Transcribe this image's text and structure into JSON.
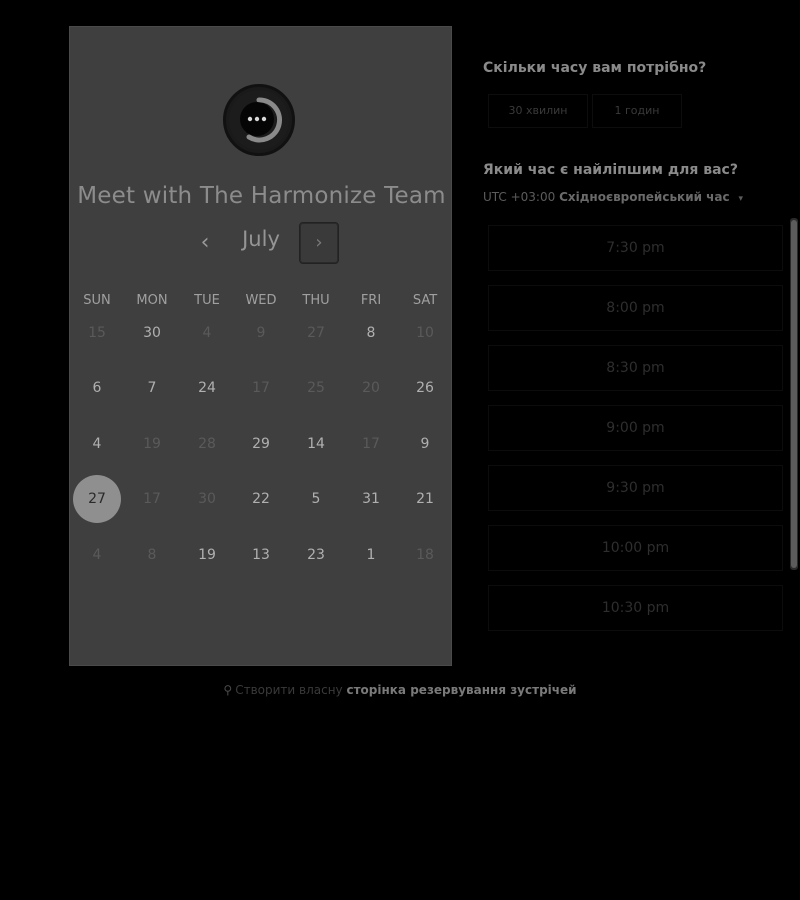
{
  "calendar": {
    "title": "Meet with The Harmonize Team",
    "month": "July",
    "prev_icon": "‹",
    "next_icon": "›",
    "weekdays": [
      "SUN",
      "MON",
      "TUE",
      "WED",
      "THU",
      "FRI",
      "SAT"
    ],
    "weeks": [
      [
        {
          "d": "15",
          "m": true
        },
        {
          "d": "30",
          "m": false
        },
        {
          "d": "4",
          "m": true
        },
        {
          "d": "9",
          "m": true
        },
        {
          "d": "27",
          "m": true
        },
        {
          "d": "8",
          "m": false
        },
        {
          "d": "10",
          "m": true
        }
      ],
      [
        {
          "d": "6",
          "m": false
        },
        {
          "d": "7",
          "m": false
        },
        {
          "d": "24",
          "m": false
        },
        {
          "d": "17",
          "m": true
        },
        {
          "d": "25",
          "m": true
        },
        {
          "d": "20",
          "m": true
        },
        {
          "d": "26",
          "m": false
        }
      ],
      [
        {
          "d": "4",
          "m": false
        },
        {
          "d": "19",
          "m": true
        },
        {
          "d": "28",
          "m": true
        },
        {
          "d": "29",
          "m": false
        },
        {
          "d": "14",
          "m": false
        },
        {
          "d": "17",
          "m": true
        },
        {
          "d": "9",
          "m": false
        }
      ],
      [
        {
          "d": "27",
          "m": false,
          "sel": true
        },
        {
          "d": "17",
          "m": true
        },
        {
          "d": "30",
          "m": true
        },
        {
          "d": "22",
          "m": false
        },
        {
          "d": "5",
          "m": false
        },
        {
          "d": "31",
          "m": false
        },
        {
          "d": "21",
          "m": false
        }
      ],
      [
        {
          "d": "4",
          "m": true
        },
        {
          "d": "8",
          "m": true
        },
        {
          "d": "19",
          "m": false
        },
        {
          "d": "13",
          "m": false
        },
        {
          "d": "23",
          "m": false
        },
        {
          "d": "1",
          "m": false
        },
        {
          "d": "18",
          "m": true
        }
      ]
    ]
  },
  "booking": {
    "duration_question": "Скільки часу вам потрібно?",
    "durations": [
      "30 хвилин",
      "1 годин"
    ],
    "time_question": "Який час є найліпшим для вас?",
    "timezone_offset": "UTC +03:00",
    "timezone_name": "Східноєвропейський час",
    "timezone_caret": "▾",
    "slots": [
      "7:30 pm",
      "8:00 pm",
      "8:30 pm",
      "9:00 pm",
      "9:30 pm",
      "10:00 pm",
      "10:30 pm"
    ]
  },
  "footer": {
    "logo_glyph": "⚲",
    "prefix": "Створити власну",
    "link": "сторінка резервування зустрічей"
  }
}
